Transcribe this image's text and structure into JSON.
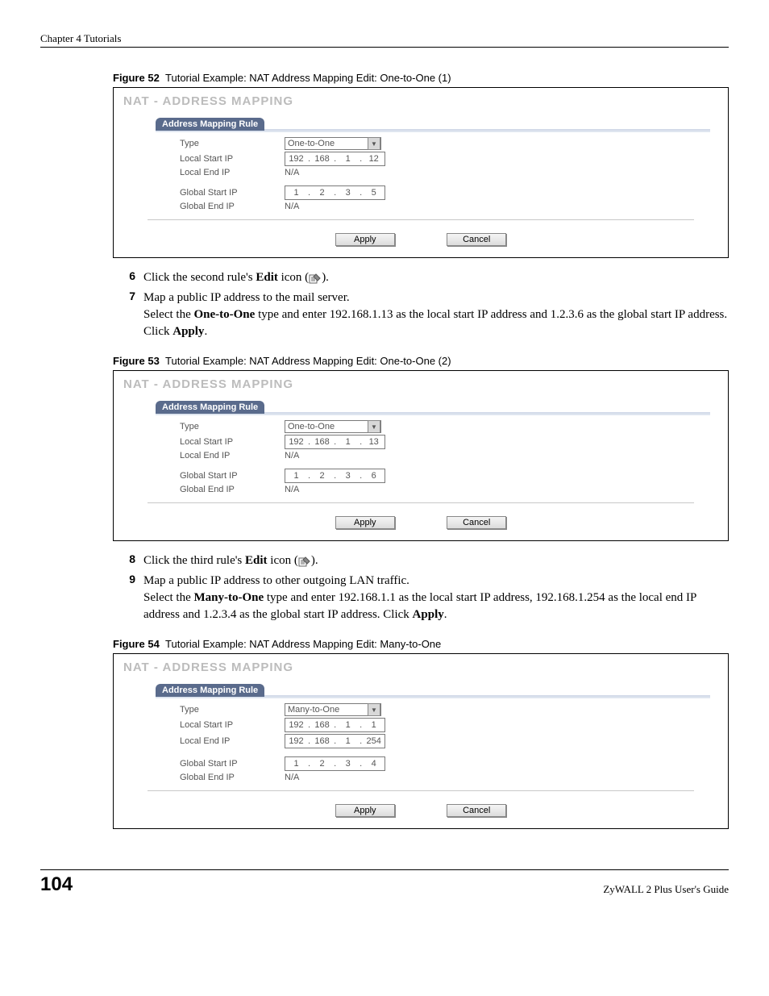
{
  "header": {
    "chapter": "Chapter 4 Tutorials"
  },
  "fig52": {
    "num": "Figure 52",
    "caption": "Tutorial Example: NAT Address Mapping Edit: One-to-One (1)",
    "title": "NAT - ADDRESS MAPPING",
    "section": "Address Mapping Rule",
    "labels": {
      "type": "Type",
      "lstart": "Local Start IP",
      "lend": "Local End IP",
      "gstart": "Global Start IP",
      "gend": "Global End IP"
    },
    "type_value": "One-to-One",
    "lstart": [
      "192",
      "168",
      "1",
      "12"
    ],
    "lend": "N/A",
    "gstart": [
      "1",
      "2",
      "3",
      "5"
    ],
    "gend": "N/A",
    "apply": "Apply",
    "cancel": "Cancel"
  },
  "steps67": {
    "s6": {
      "num": "6",
      "text_a": "Click the second rule's ",
      "bold": "Edit",
      "text_b": " icon (",
      "text_c": ")."
    },
    "s7": {
      "num": "7",
      "line1": "Map a public IP address to the mail server.",
      "line2_a": "Select the ",
      "line2_bold1": "One-to-One",
      "line2_b": " type and enter 192.168.1.13 as the local start IP address and 1.2.3.6 as the global start IP address. Click ",
      "line2_bold2": "Apply",
      "line2_c": "."
    }
  },
  "fig53": {
    "num": "Figure 53",
    "caption": "Tutorial Example: NAT Address Mapping Edit: One-to-One (2)",
    "title": "NAT - ADDRESS MAPPING",
    "section": "Address Mapping Rule",
    "type_value": "One-to-One",
    "lstart": [
      "192",
      "168",
      "1",
      "13"
    ],
    "lend": "N/A",
    "gstart": [
      "1",
      "2",
      "3",
      "6"
    ],
    "gend": "N/A",
    "apply": "Apply",
    "cancel": "Cancel"
  },
  "steps89": {
    "s8": {
      "num": "8",
      "text_a": "Click the third rule's ",
      "bold": "Edit",
      "text_b": " icon (",
      "text_c": ")."
    },
    "s9": {
      "num": "9",
      "line1": "Map a public IP address to other outgoing LAN traffic.",
      "line2_a": "Select the ",
      "line2_bold1": "Many-to-One",
      "line2_b": " type and enter 192.168.1.1 as the local start IP address, 192.168.1.254 as the local end IP address and 1.2.3.4 as the global start IP address. Click ",
      "line2_bold2": "Apply",
      "line2_c": "."
    }
  },
  "fig54": {
    "num": "Figure 54",
    "caption": "Tutorial Example: NAT Address Mapping Edit: Many-to-One",
    "title": "NAT - ADDRESS MAPPING",
    "section": "Address Mapping Rule",
    "type_value": "Many-to-One",
    "lstart": [
      "192",
      "168",
      "1",
      "1"
    ],
    "lend": [
      "192",
      "168",
      "1",
      "254"
    ],
    "gstart": [
      "1",
      "2",
      "3",
      "4"
    ],
    "gend": "N/A",
    "apply": "Apply",
    "cancel": "Cancel"
  },
  "footer": {
    "page": "104",
    "guide": "ZyWALL 2 Plus User's Guide"
  }
}
